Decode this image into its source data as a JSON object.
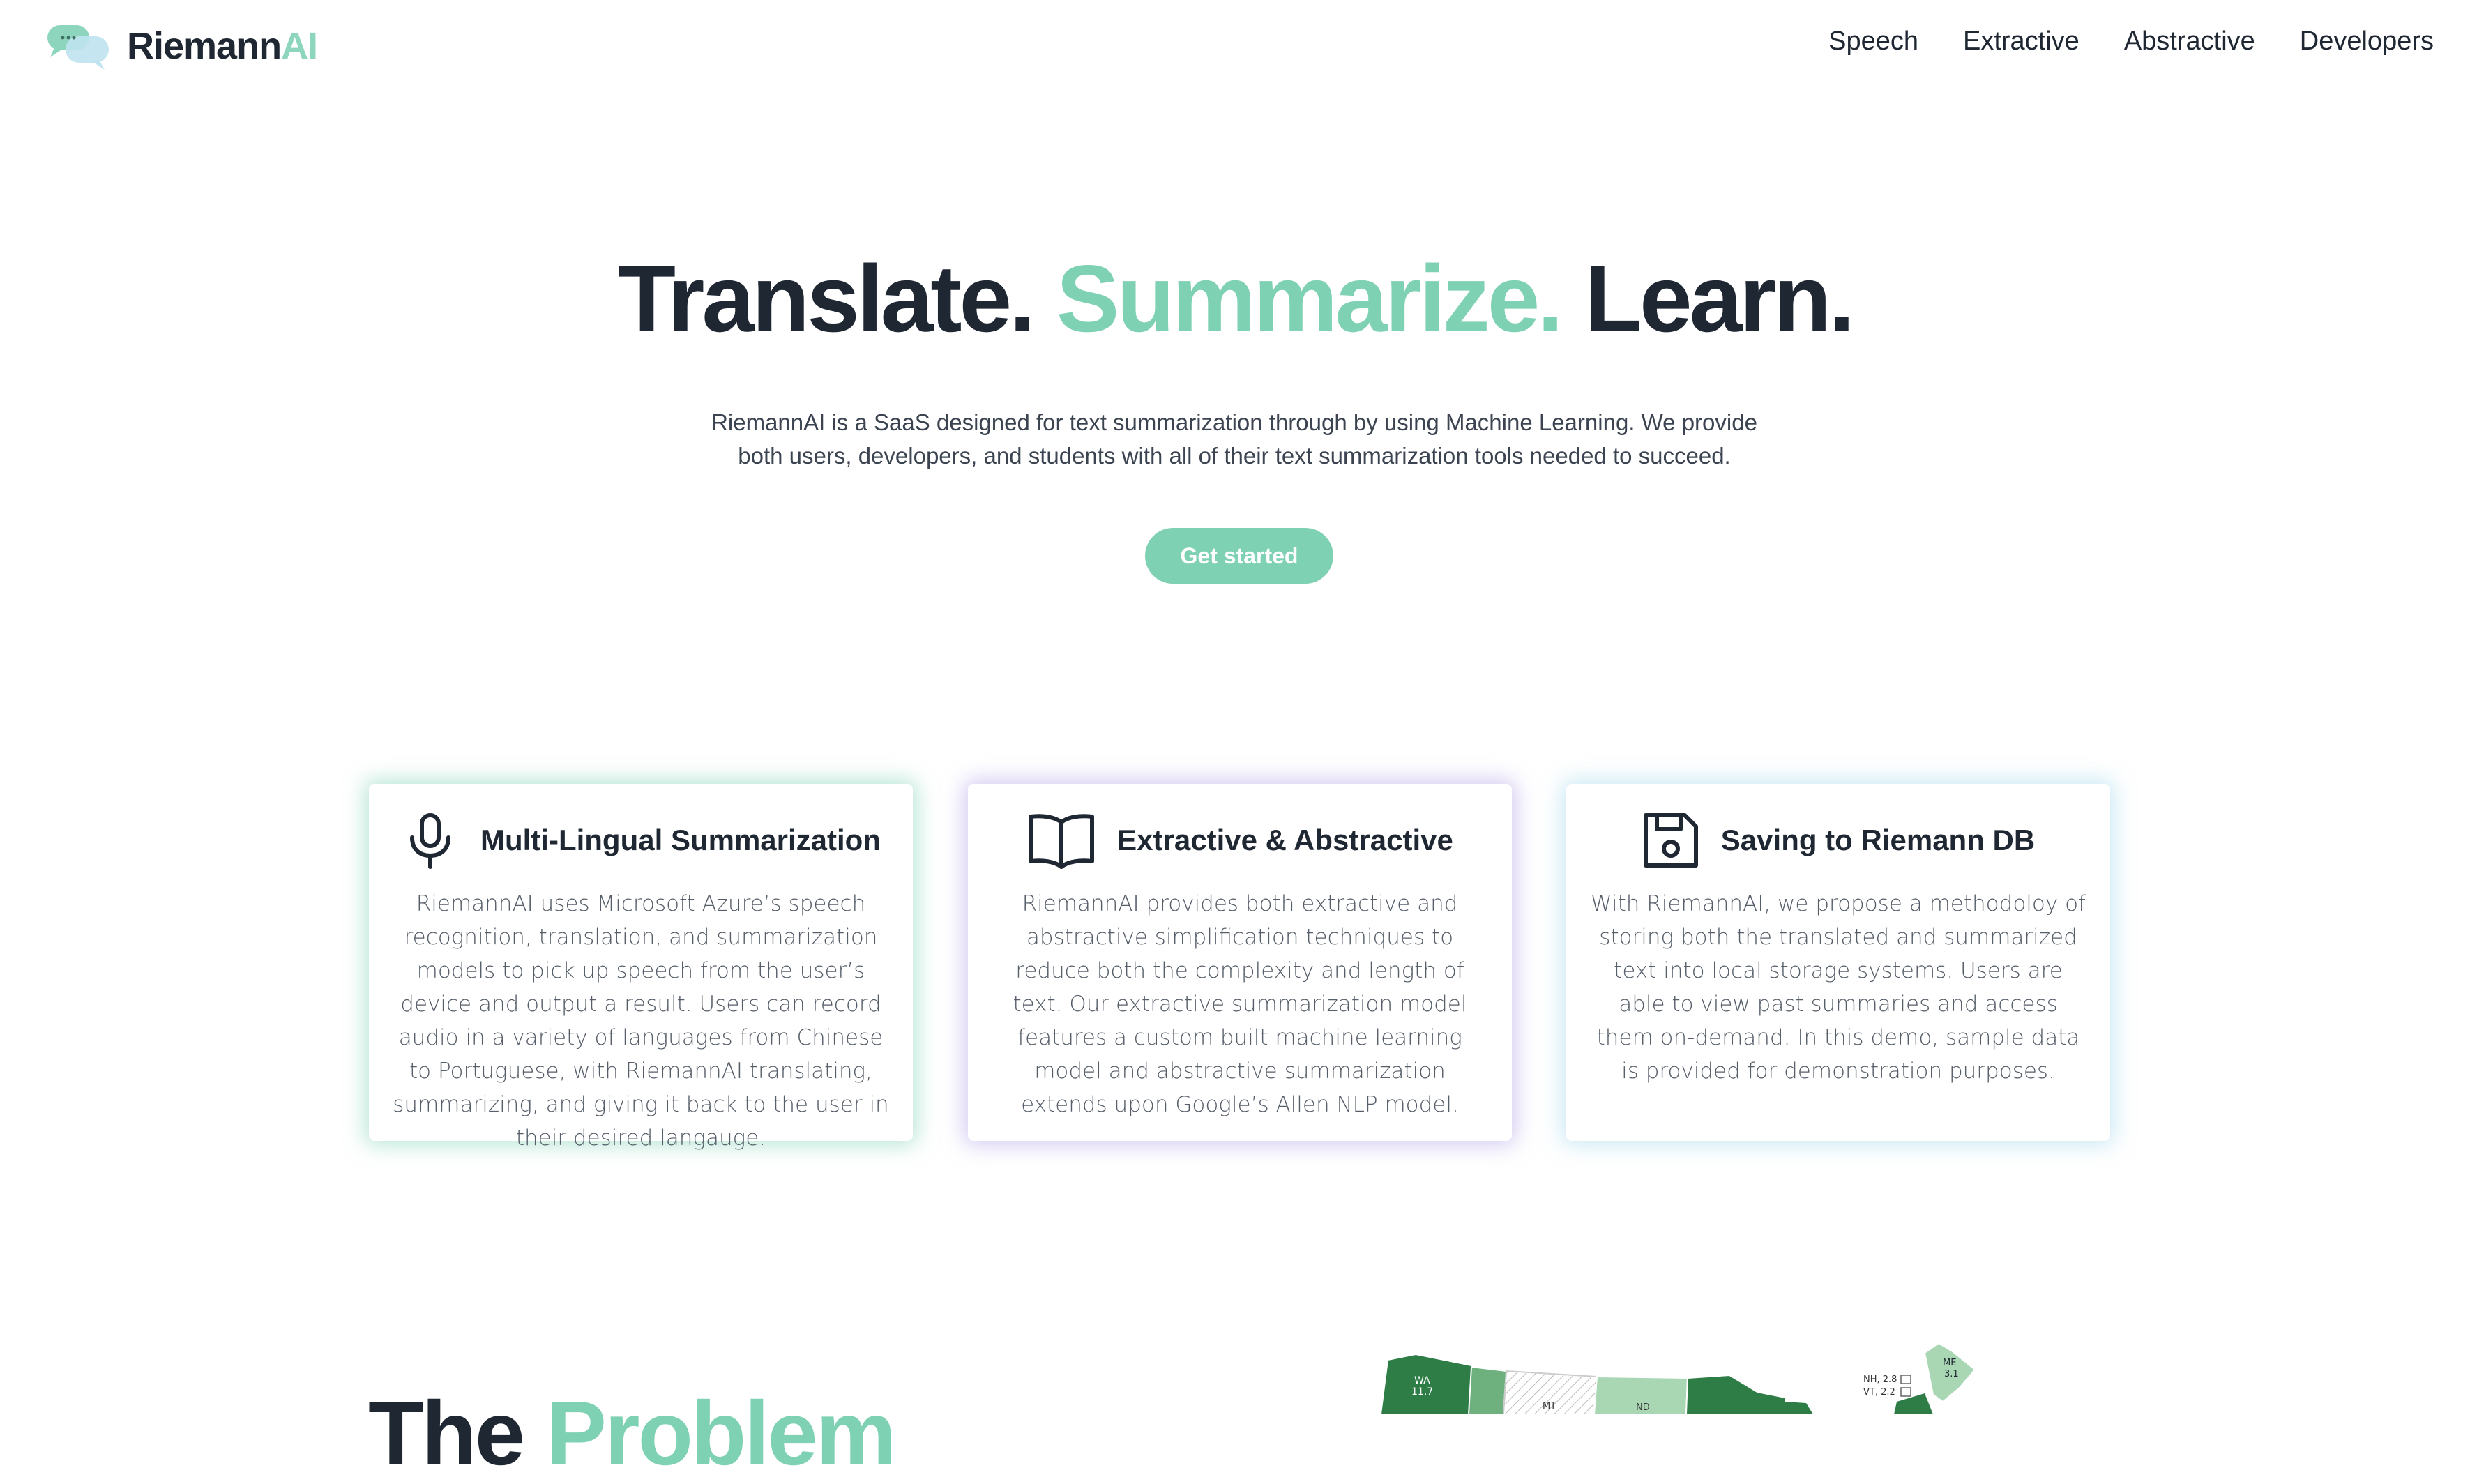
{
  "brand": {
    "name_dark": "Riemann",
    "name_accent": "AI"
  },
  "nav": {
    "links": [
      {
        "label": "Speech"
      },
      {
        "label": "Extractive"
      },
      {
        "label": "Abstractive"
      },
      {
        "label": "Developers"
      }
    ]
  },
  "hero": {
    "title_word1": "Translate.",
    "title_word2": "Summarize.",
    "title_word3": "Learn.",
    "description": "RiemannAI is a SaaS designed for text summarization through by using Machine Learning. We provide both users, developers, and students with all of their text summarization tools needed to succeed.",
    "cta_label": "Get started"
  },
  "features": [
    {
      "icon": "microphone-icon",
      "title": "Multi-Lingual Summarization",
      "body": "RiemannAI uses Microsoft Azure’s speech recognition, translation, and summarization models to pick up speech from the user’s device and output a result. Users can record audio in a variety of languages from Chinese to Portuguese, with RiemannAI translating, summarizing, and giving it back to the user in their desired langauge."
    },
    {
      "icon": "book-icon",
      "title": "Extractive & Abstractive",
      "body": "RiemannAI provides both extractive and abstractive simplification techniques to reduce both the complexity and length of text. Our extractive summarization model features a custom built machine learning model and abstractive summarization extends upon Google’s Allen NLP model."
    },
    {
      "icon": "floppy-disk-icon",
      "title": "Saving to Riemann DB",
      "body": "With RiemannAI, we propose a methodoloy of storing both the translated and summarized text into local storage systems. Users are able to view past summaries and access them on-demand. In this demo, sample data is provided for demonstration purposes."
    }
  ],
  "problem_section": {
    "title_word1": "The",
    "title_word2": "Problem",
    "map_labels": {
      "wa": "WA",
      "wa_value": "11.7",
      "mt": "MT",
      "nd": "ND",
      "nh": "NH, 2.8",
      "vt": "VT, 2.2",
      "me": "ME",
      "me_value": "3.1"
    }
  },
  "colors": {
    "accent": "#7fd1b4",
    "text_dark": "#1f2733",
    "text_body": "#565e69",
    "glow_green": "#7fd1b4",
    "glow_purple": "#b0a0e6",
    "glow_blue": "#a0d7eb",
    "map_dark_green": "#2e7d46",
    "map_light_green": "#a9d7b4"
  }
}
